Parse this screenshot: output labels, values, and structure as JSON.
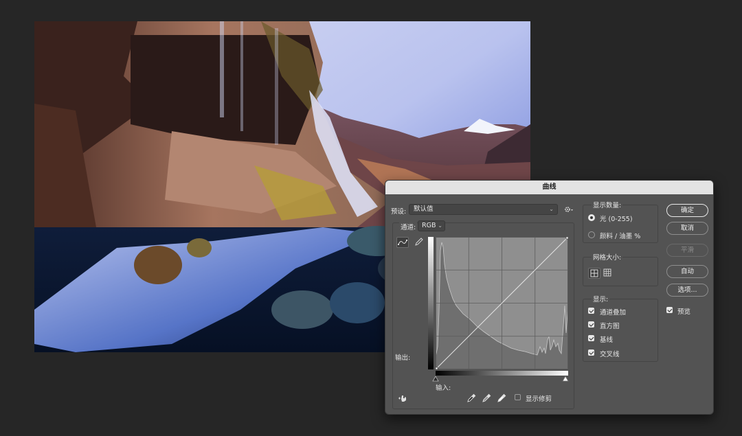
{
  "dialog": {
    "title": "曲线",
    "preset_label": "预设:",
    "preset_value": "默认值",
    "channel_label": "通道:",
    "channel_value": "RGB",
    "output_label": "输出:",
    "input_label": "输入:",
    "show_clipping_label": "显示修剪",
    "show_clipping_checked": false,
    "show_amount": {
      "title": "显示数量:",
      "options": [
        {
          "label": "光 (0-255)",
          "selected": true
        },
        {
          "label": "颜料 / 油墨 %",
          "selected": false
        }
      ]
    },
    "grid_size": {
      "title": "网格大小:",
      "selected": "simple"
    },
    "show": {
      "title": "显示:",
      "items": [
        {
          "label": "通道叠加",
          "checked": true
        },
        {
          "label": "直方图",
          "checked": true
        },
        {
          "label": "基线",
          "checked": true
        },
        {
          "label": "交叉线",
          "checked": true
        }
      ]
    },
    "buttons": {
      "ok": "确定",
      "cancel": "取消",
      "smooth": "平滑",
      "auto": "自动",
      "options": "选项..."
    },
    "preview_label": "预览",
    "preview_checked": true
  },
  "colors": {
    "app_background": "#262626",
    "dialog_background": "#535353",
    "titlebar": "#e3e3e3",
    "histogram": "#8c8c8c"
  },
  "icons": {
    "preset_settings": "gear-icon",
    "curve_tool": "curve-points-icon",
    "pencil_tool": "pencil-icon",
    "targeted_adjust": "hand-adjust-icon",
    "black_eyedropper": "eyedropper-black-icon",
    "gray_eyedropper": "eyedropper-gray-icon",
    "white_eyedropper": "eyedropper-white-icon"
  }
}
